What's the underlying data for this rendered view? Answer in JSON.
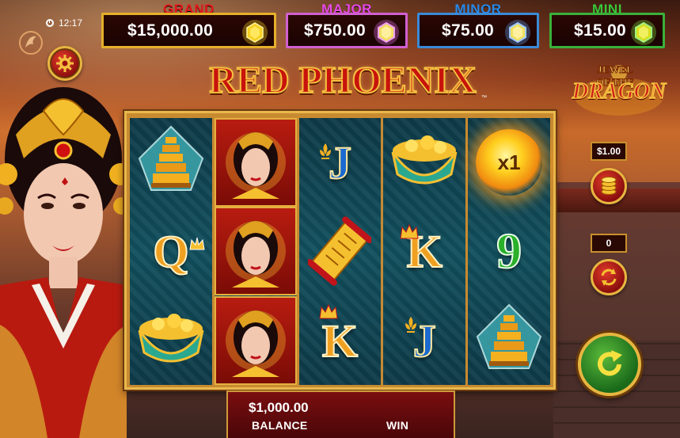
{
  "clock": {
    "time": "12:17"
  },
  "jackpots": [
    {
      "name": "GRAND",
      "amount": "$15,000.00",
      "label_color": "#e41a1a",
      "border_color": "#e6b02a",
      "gem_color": "#f5d020"
    },
    {
      "name": "MAJOR",
      "amount": "$750.00",
      "label_color": "#e84ae8",
      "border_color": "#d060d0",
      "gem_color": "#e070e8"
    },
    {
      "name": "MINOR",
      "amount": "$75.00",
      "label_color": "#2a8ae8",
      "border_color": "#3a8ad8",
      "gem_color": "#f0e060"
    },
    {
      "name": "MINI",
      "amount": "$15.00",
      "label_color": "#3ac83a",
      "border_color": "#3ab03a",
      "gem_color": "#c8e020"
    }
  ],
  "title": {
    "text": "RED PHOENIX",
    "trademark": "™"
  },
  "side_logo": {
    "top": "JEWEL OF THE",
    "main": "DRAGON"
  },
  "reels": [
    [
      "pagoda",
      "Q",
      "bowl"
    ],
    [
      "empress",
      "empress",
      "empress"
    ],
    [
      "J",
      "scroll",
      "K"
    ],
    [
      "bowl",
      "K",
      "J"
    ],
    [
      "x1",
      "9",
      "pagoda"
    ]
  ],
  "multiplier": "x1",
  "controls": {
    "bet": "$1.00",
    "autoplay_count": "0"
  },
  "balance": {
    "value": "$1,000.00",
    "label": "BALANCE"
  },
  "win": {
    "label": "WIN"
  },
  "colors": {
    "frame_gold": "#e9b84c",
    "reel_teal": "#12505e",
    "button_red": "#c0201a",
    "spin_green": "#2a8a2a"
  }
}
